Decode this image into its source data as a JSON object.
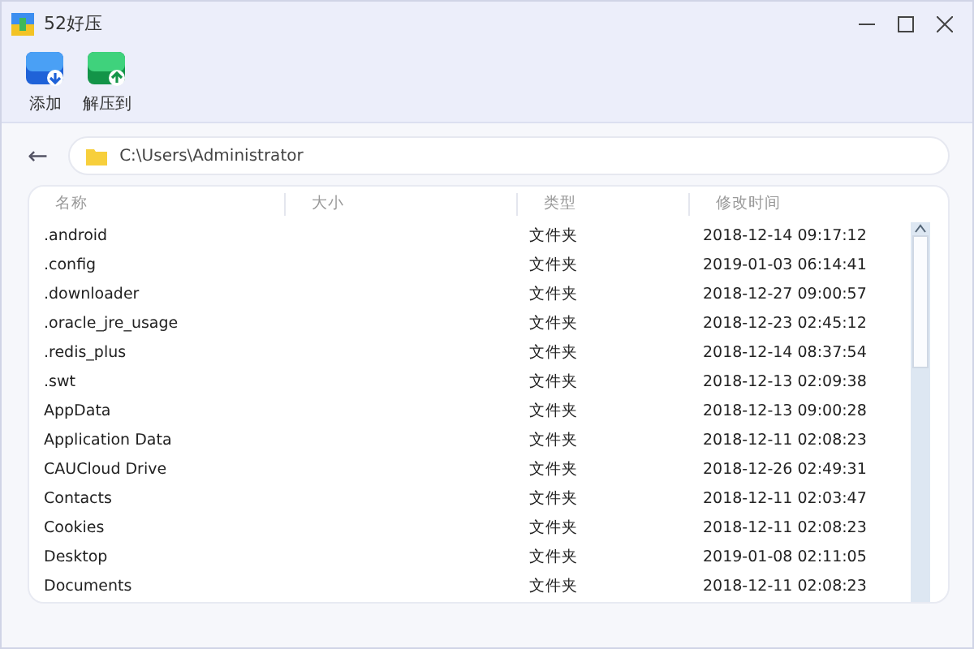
{
  "window": {
    "title": "52好压"
  },
  "toolbar": [
    {
      "label": "添加",
      "kind": "add"
    },
    {
      "label": "解压到",
      "kind": "extract"
    }
  ],
  "address": {
    "back": "←",
    "path": "C:\\Users\\Administrator"
  },
  "table": {
    "columns": [
      "名称",
      "大小",
      "类型",
      "修改时间"
    ],
    "rows": [
      {
        "name": ".android",
        "type": "文件夹",
        "modified": "2018-12-14 09:17:12"
      },
      {
        "name": ".config",
        "type": "文件夹",
        "modified": "2019-01-03 06:14:41"
      },
      {
        "name": ".downloader",
        "type": "文件夹",
        "modified": "2018-12-27 09:00:57"
      },
      {
        "name": ".oracle_jre_usage",
        "type": "文件夹",
        "modified": "2018-12-23 02:45:12"
      },
      {
        "name": ".redis_plus",
        "type": "文件夹",
        "modified": "2018-12-14 08:37:54"
      },
      {
        "name": ".swt",
        "type": "文件夹",
        "modified": "2018-12-13 02:09:38"
      },
      {
        "name": "AppData",
        "type": "文件夹",
        "modified": "2018-12-13 09:00:28"
      },
      {
        "name": "Application Data",
        "type": "文件夹",
        "modified": "2018-12-11 02:08:23"
      },
      {
        "name": "CAUCloud Drive",
        "type": "文件夹",
        "modified": "2018-12-26 02:49:31"
      },
      {
        "name": "Contacts",
        "type": "文件夹",
        "modified": "2018-12-11 02:03:47"
      },
      {
        "name": "Cookies",
        "type": "文件夹",
        "modified": "2018-12-11 02:08:23"
      },
      {
        "name": "Desktop",
        "type": "文件夹",
        "modified": "2019-01-08 02:11:05"
      },
      {
        "name": "Documents",
        "type": "文件夹",
        "modified": "2018-12-11 02:08:23"
      }
    ]
  }
}
